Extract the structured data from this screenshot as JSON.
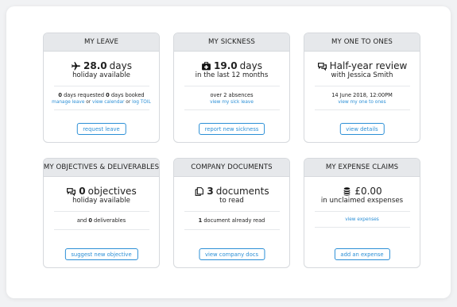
{
  "cards": [
    {
      "title": "MY LEAVE",
      "icon": "plane-icon",
      "big_value": "28.0",
      "big_unit": "days",
      "subtitle": "holiday available",
      "detail_num1": "0",
      "detail_text1": "days requested",
      "detail_num2": "0",
      "detail_text2": "days booked",
      "links": [
        "manage leave",
        "view calendar",
        "log TOIL"
      ],
      "link_sep": "or",
      "button": "request leave"
    },
    {
      "title": "MY SICKNESS",
      "icon": "medical-kit-icon",
      "big_value": "19.0",
      "big_unit": "days",
      "subtitle": "in the last 12 months",
      "detail": "over 2 absences",
      "link": "view my sick leave",
      "button": "report new sickness"
    },
    {
      "title": "MY ONE TO ONES",
      "icon": "chat-icon",
      "big_text": "Half-year review",
      "subtitle": "with Jessica Smith",
      "detail": "14 June 2018, 12:00PM",
      "link": "view my one to ones",
      "button": "view details"
    },
    {
      "title": "MY OBJECTIVES & DELIVERABLES",
      "icon": "chat-icon",
      "big_value": "0",
      "big_unit": "objectives",
      "subtitle": "holiday available",
      "detail_pre": "and",
      "detail_num": "0",
      "detail_post": "deliverables",
      "button": "suggest new objective"
    },
    {
      "title": "COMPANY DOCUMENTS",
      "icon": "documents-icon",
      "big_value": "3",
      "big_unit": "documents",
      "subtitle": "to read",
      "detail_num": "1",
      "detail_post": "document already read",
      "button": "view company docs"
    },
    {
      "title": "MY EXPENSE CLAIMS",
      "icon": "coins-icon",
      "big_text": "£0.00",
      "subtitle": "in unclaimed exspenses",
      "link": "view expenses",
      "button": "add an expense"
    }
  ],
  "colors": {
    "accent": "#2b8fd6",
    "header_bg": "#e6e8eb",
    "border": "#d6d9dd"
  }
}
